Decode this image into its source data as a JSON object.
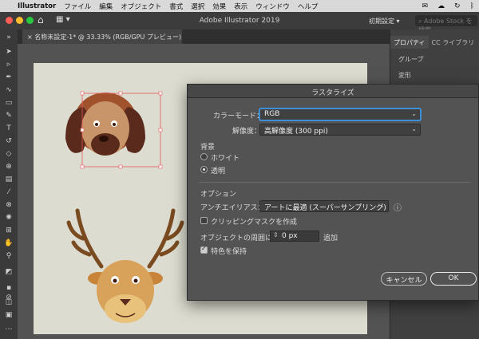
{
  "menubar": {
    "app": "Illustrator",
    "items": [
      "ファイル",
      "編集",
      "オブジェクト",
      "書式",
      "選択",
      "効果",
      "表示",
      "ウィンドウ",
      "ヘルプ"
    ]
  },
  "appbar": {
    "title": "Adobe Illustrator 2019",
    "preset": "初期設定 ▾",
    "stock_placeholder": "Adobe Stock を検索"
  },
  "document_tab": {
    "label": "名称未設定-1* @ 33.33% (RGB/GPU プレビュー)"
  },
  "right_panel": {
    "tabs": [
      "プロパティ",
      "CC ライブラリ"
    ],
    "section1": "グループ",
    "section2": "変形"
  },
  "dialog": {
    "title": "ラスタライズ",
    "color_mode_label": "カラーモード：",
    "color_mode_value": "RGB",
    "resolution_label": "解像度：",
    "resolution_value": "高解像度 (300 ppi)",
    "background_heading": "背景",
    "bg_white": "ホワイト",
    "bg_transparent": "透明",
    "options_heading": "オプション",
    "antialias_label": "アンチエイリアス：",
    "antialias_value": "アートに最適 (スーパーサンプリング)",
    "clipping_mask": "クリッピングマスクを作成",
    "add_around_label": "オブジェクトの周囲に",
    "add_around_value": "0 px",
    "add_suffix": "追加",
    "preserve_spot": "特色を保持",
    "cancel": "キャンセル",
    "ok": "OK"
  },
  "colors": {
    "dialog_bg": "#535353",
    "focus_ring": "#3d8fd6",
    "artboard": "#dcdcd0",
    "dog_face": "#c8956a",
    "dog_ear": "#5a2a1c",
    "deer_face": "#d9a25a",
    "antler": "#7a4a20"
  }
}
